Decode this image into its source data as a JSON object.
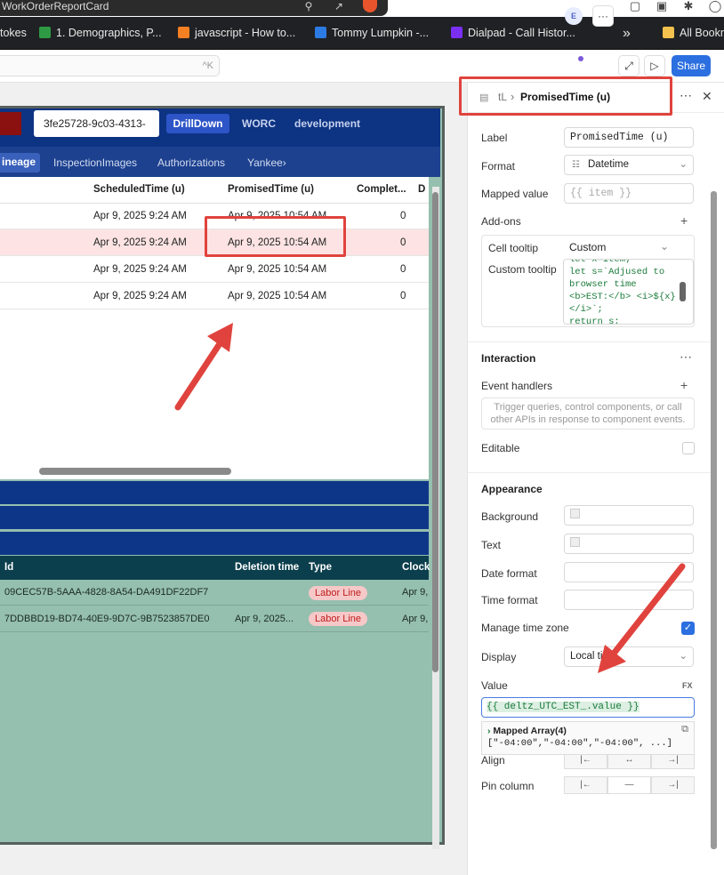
{
  "browser": {
    "tab_title": "WorkOrderReportCard",
    "bookmarks": [
      {
        "label": "tokes",
        "color": "#202124"
      },
      {
        "label": "1. Demographics, P...",
        "color": "#2e9a44"
      },
      {
        "label": "javascript - How to...",
        "color": "#f48024"
      },
      {
        "label": "Tommy Lumpkin -...",
        "color": "#2c7be5"
      },
      {
        "label": "Dialpad - Call Histor...",
        "color": "#7b2ff2"
      },
      {
        "label": "All Bookm",
        "color": "#f2c14e"
      }
    ],
    "overflow": "»"
  },
  "toolbar": {
    "search_shortcut": "^K",
    "avatar_initial": "E",
    "more": "···",
    "share_label": "Share"
  },
  "app": {
    "record_id": "3fe25728-9c03-4313-",
    "nav_tabs": [
      "DrillDown",
      "WORC",
      "development"
    ],
    "sub_tabs": [
      "ineage",
      "InspectionImages",
      "Authorizations",
      "Yankee›"
    ],
    "table": {
      "columns": [
        "ScheduledTime (u)",
        "PromisedTime (u)",
        "Complet...",
        "D"
      ],
      "rows": [
        {
          "scheduled": "Apr 9, 2025 9:24 AM",
          "promised": "Apr 9, 2025 10:54 AM",
          "completed": "0"
        },
        {
          "scheduled": "Apr 9, 2025 9:24 AM",
          "promised": "Apr 9, 2025 10:54 AM",
          "completed": "0"
        },
        {
          "scheduled": "Apr 9, 2025 9:24 AM",
          "promised": "Apr 9, 2025 10:54 AM",
          "completed": "0"
        },
        {
          "scheduled": "Apr 9, 2025 9:24 AM",
          "promised": "Apr 9, 2025 10:54 AM",
          "completed": "0"
        }
      ]
    },
    "table2": {
      "columns": [
        "Id",
        "Deletion time",
        "Type",
        "Clock"
      ],
      "rows": [
        {
          "id": "09CEC57B-5AAA-4828-8A54-DA491DF22DF7",
          "deletion": "",
          "type": "Labor Line",
          "clock": "Apr 9,"
        },
        {
          "id": "7DDBBD19-BD74-40E9-9D7C-9B7523857DE0",
          "deletion": "Apr 9, 2025...",
          "type": "Labor Line",
          "clock": "Apr 9,"
        }
      ]
    }
  },
  "inspector": {
    "breadcrumb_parent": "tL",
    "breadcrumb_sep": "›",
    "breadcrumb_current": "PromisedTime (u)",
    "label_label": "Label",
    "label_value": "PromisedTime (u)",
    "format_label": "Format",
    "format_value": "Datetime",
    "mapped_label": "Mapped value",
    "mapped_placeholder": "{{ item }}",
    "addons_label": "Add-ons",
    "cell_tooltip_label": "Cell tooltip",
    "cell_tooltip_value": "Custom",
    "custom_tooltip_label": "Custom tooltip",
    "code_lines": [
      "let x=item;",
      "  let s=`Adjused to",
      "browser time",
      "<b>EST:</b> <i>${x}",
      "</i>`;",
      "  return s;"
    ],
    "interaction_label": "Interaction",
    "event_handlers_label": "Event handlers",
    "event_hint": "Trigger queries, control components, or call other APIs in response to component events.",
    "editable_label": "Editable",
    "appearance_label": "Appearance",
    "background_label": "Background",
    "text_label": "Text",
    "date_format_label": "Date format",
    "time_format_label": "Time format",
    "manage_tz_label": "Manage time zone",
    "display_label": "Display",
    "display_value": "Local time",
    "value_label": "Value",
    "fx_label": "FX",
    "value_expr": "{{ deltz_UTC_EST_.value }}",
    "mapped_array_label": "Mapped Array(4)",
    "mapped_array_value": "[\"-04:00\",\"-04:00\",\"-04:00\", ...]",
    "align_label": "Align",
    "pin_label": "Pin column",
    "pin_none": "—"
  }
}
